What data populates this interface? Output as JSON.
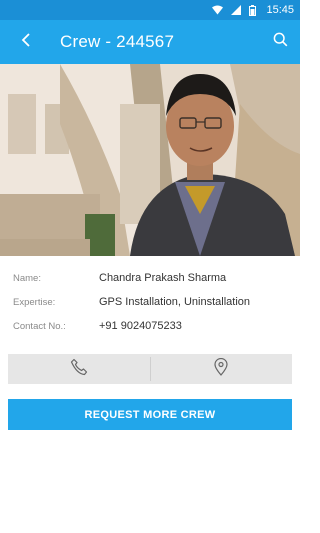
{
  "status_bar": {
    "time": "15:45",
    "icons": [
      "wifi-icon",
      "signal-icon",
      "battery-icon"
    ]
  },
  "app_bar": {
    "title": "Crew - 244567",
    "back_icon": "arrow-back-icon",
    "search_icon": "search-icon"
  },
  "profile": {
    "photo": "crew-member-photo",
    "fields": [
      {
        "label": "Name:",
        "value": "Chandra Prakash Sharma"
      },
      {
        "label": "Expertise:",
        "value": "GPS Installation, Uninstallation"
      },
      {
        "label": "Contact No.:",
        "value": "+91 9024075233"
      }
    ]
  },
  "actions": {
    "call_icon": "phone-icon",
    "location_icon": "location-pin-icon"
  },
  "cta": {
    "label": "REQUEST MORE CREW"
  },
  "colors": {
    "primary": "#22a6ea",
    "status_bar": "#1b8fd6",
    "action_bg": "#e6e6e6",
    "label_text": "#8a8a8a",
    "value_text": "#333333"
  }
}
